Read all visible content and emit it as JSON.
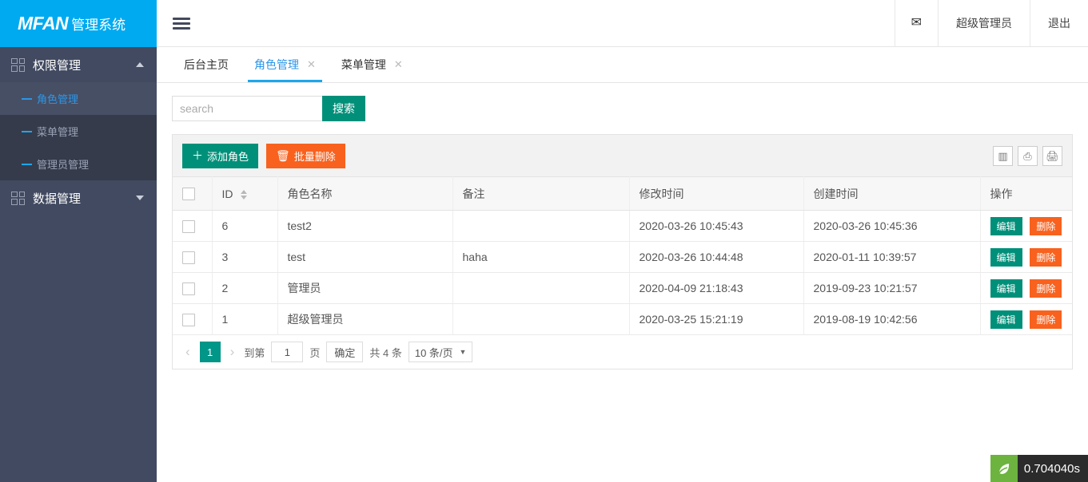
{
  "brand": {
    "mark": "MFAN",
    "sub": "管理系统"
  },
  "sidebar": {
    "groups": [
      {
        "label": "权限管理",
        "icon": "grid-icon",
        "expanded": true,
        "caret": "up",
        "items": [
          {
            "label": "角色管理",
            "active": true
          },
          {
            "label": "菜单管理",
            "active": false
          },
          {
            "label": "管理员管理",
            "active": false
          }
        ]
      },
      {
        "label": "数据管理",
        "icon": "grid-icon",
        "expanded": false,
        "caret": "down",
        "items": []
      }
    ]
  },
  "topbar": {
    "menu_icon": "hamburger-icon",
    "mail_icon": "✉",
    "user": "超级管理员",
    "logout": "退出"
  },
  "tabs": [
    {
      "label": "后台主页",
      "active": false,
      "closable": false
    },
    {
      "label": "角色管理",
      "active": true,
      "closable": true
    },
    {
      "label": "菜单管理",
      "active": false,
      "closable": true
    }
  ],
  "search": {
    "value": "",
    "placeholder": "search",
    "button": "搜索"
  },
  "toolbar": {
    "add_label": "添加角色",
    "add_icon": "＋",
    "delete_label": "批量删除",
    "delete_icon": "🗑",
    "icons": [
      {
        "name": "columns-icon",
        "glyph": "▥"
      },
      {
        "name": "export-icon",
        "glyph": "⎙"
      },
      {
        "name": "print-icon",
        "glyph": "🖨"
      }
    ]
  },
  "table": {
    "columns": [
      "",
      "ID",
      "角色名称",
      "备注",
      "修改时间",
      "创建时间",
      "操作"
    ],
    "rows": [
      {
        "id": "6",
        "name": "test2",
        "remark": "",
        "updated": "2020-03-26 10:45:43",
        "created": "2020-03-26 10:45:36"
      },
      {
        "id": "3",
        "name": "test",
        "remark": "haha",
        "updated": "2020-03-26 10:44:48",
        "created": "2020-01-11 10:39:57"
      },
      {
        "id": "2",
        "name": "管理员",
        "remark": "",
        "updated": "2020-04-09 21:18:43",
        "created": "2019-09-23 10:21:57"
      },
      {
        "id": "1",
        "name": "超级管理员",
        "remark": "",
        "updated": "2020-03-25 15:21:19",
        "created": "2019-08-19 10:42:56"
      }
    ],
    "action_edit": "编辑",
    "action_delete": "删除"
  },
  "pager": {
    "prev": "‹",
    "current": "1",
    "next": "›",
    "goto_label": "到第",
    "goto_value": "1",
    "page_unit": "页",
    "confirm": "确定",
    "total": "共 4 条",
    "page_size": "10 条/页",
    "arrow": "▼"
  },
  "debug": {
    "time": "0.704040s"
  },
  "colors": {
    "brand_cyan": "#00aaf0",
    "sidebar": "#414a60",
    "sidebar_sub": "#353b4b",
    "accent_blue": "#2b96e8",
    "teal": "#00907a",
    "orange": "#f8621e"
  }
}
